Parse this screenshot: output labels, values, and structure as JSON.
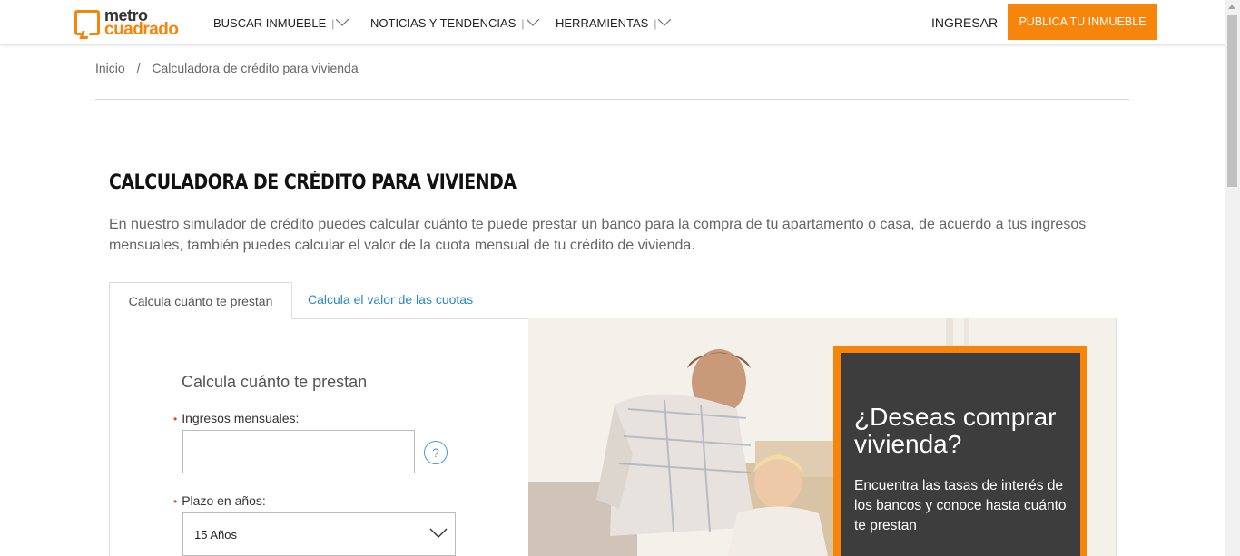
{
  "header": {
    "logo_top": "metro",
    "logo_bottom": "cuadrado",
    "nav": [
      {
        "label": "BUSCAR INMUEBLE"
      },
      {
        "label": "NOTICIAS Y TENDENCIAS"
      },
      {
        "label": "HERRAMIENTAS"
      }
    ],
    "nav_separator": "|",
    "login_label": "INGRESAR",
    "publish_label": "PUBLICA TU INMUEBLE"
  },
  "breadcrumb": {
    "home": "Inicio",
    "separator": "/",
    "current": "Calculadora de crédito para vivienda"
  },
  "page": {
    "title": "CALCULADORA DE CRÉDITO PARA VIVIENDA",
    "description": "En nuestro simulador de crédito puedes calcular cuánto te puede prestar un banco para la compra de tu apartamento o casa, de acuerdo a tus ingresos mensuales, también puedes calcular el valor de la cuota mensual de tu crédito de vivienda."
  },
  "tabs": [
    {
      "label": "Calcula cuánto te prestan",
      "active": true
    },
    {
      "label": "Calcula el valor de las cuotas",
      "active": false
    }
  ],
  "form": {
    "title": "Calcula cuánto te prestan",
    "required_mark": "•",
    "income_label": "Ingresos mensuales:",
    "income_value": "",
    "help_glyph": "?",
    "term_label": "Plazo en años:",
    "term_value": "15 Años"
  },
  "promo": {
    "title": "¿Deseas comprar vivienda?",
    "text": "Encuentra las tasas de interés de los bancos y conoce hasta cuánto te prestan"
  },
  "colors": {
    "brand_orange": "#f7850b",
    "link_blue": "#2a88c6",
    "promo_bg": "#3d3d3d"
  }
}
